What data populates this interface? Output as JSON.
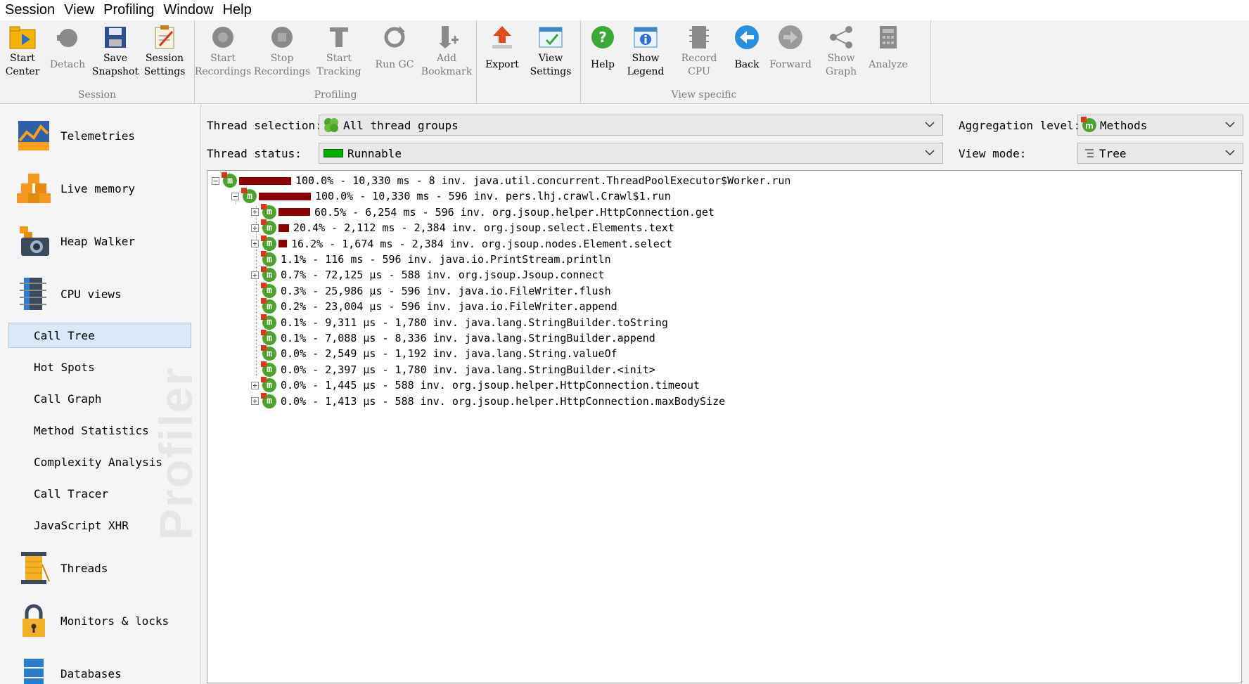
{
  "menu": [
    "Session",
    "View",
    "Profiling",
    "Window",
    "Help"
  ],
  "toolbar": {
    "groups": [
      {
        "label": "Session"
      },
      {
        "label": "Profiling"
      },
      {
        "label": ""
      },
      {
        "label": "View specific"
      }
    ],
    "buttons": {
      "start_center": "Start\nCenter",
      "detach": "Detach",
      "save_snapshot": "Save\nSnapshot",
      "session_settings": "Session\nSettings",
      "start_recordings": "Start\nRecordings",
      "stop_recordings": "Stop\nRecordings",
      "start_tracking": "Start\nTracking",
      "run_gc": "Run GC",
      "add_bookmark": "Add\nBookmark",
      "export": "Export",
      "view_settings": "View\nSettings",
      "help": "Help",
      "show_legend": "Show\nLegend",
      "record_cpu": "Record\nCPU",
      "back": "Back",
      "forward": "Forward",
      "show_graph": "Show\nGraph",
      "analyze": "Analyze"
    }
  },
  "sidebar": {
    "sections": {
      "telemetries": "Telemetries",
      "live_memory": "Live memory",
      "heap_walker": "Heap Walker",
      "cpu_views": "CPU views",
      "threads": "Threads",
      "monitors": "Monitors & locks",
      "databases": "Databases"
    },
    "cpu_items": [
      "Call Tree",
      "Hot Spots",
      "Call Graph",
      "Method Statistics",
      "Complexity Analysis",
      "Call Tracer",
      "JavaScript XHR"
    ],
    "selected": "Call Tree",
    "watermark": "Profiler"
  },
  "controls": {
    "thread_selection_label": "Thread selection:",
    "thread_selection_value": "All thread groups",
    "thread_status_label": "Thread status:",
    "thread_status_value": "Runnable",
    "aggregation_label": "Aggregation level:",
    "aggregation_value": "Methods",
    "view_mode_label": "View mode:",
    "view_mode_value": "Tree"
  },
  "tree": [
    {
      "text": "100.0% - 10,330 ms - 8 inv. java.util.concurrent.ThreadPoolExecutor$Worker.run",
      "pct": 100.0,
      "depth": 0,
      "expander": "minus"
    },
    {
      "text": "100.0% - 10,330 ms - 596 inv. pers.lhj.crawl.Crawl$1.run",
      "pct": 100.0,
      "depth": 1,
      "expander": "minus"
    },
    {
      "text": "60.5% - 6,254 ms - 596 inv. org.jsoup.helper.HttpConnection.get",
      "pct": 60.5,
      "depth": 2,
      "expander": "plus"
    },
    {
      "text": "20.4% - 2,112 ms - 2,384 inv. org.jsoup.select.Elements.text",
      "pct": 20.4,
      "depth": 2,
      "expander": "plus"
    },
    {
      "text": "16.2% - 1,674 ms - 2,384 inv. org.jsoup.nodes.Element.select",
      "pct": 16.2,
      "depth": 2,
      "expander": "plus"
    },
    {
      "text": "1.1% - 116 ms - 596 inv. java.io.PrintStream.println",
      "pct": 1.1,
      "depth": 2,
      "expander": "none"
    },
    {
      "text": "0.7% - 72,125 µs - 588 inv. org.jsoup.Jsoup.connect",
      "pct": 0.7,
      "depth": 2,
      "expander": "plus"
    },
    {
      "text": "0.3% - 25,986 µs - 596 inv. java.io.FileWriter.flush",
      "pct": 0.3,
      "depth": 2,
      "expander": "none"
    },
    {
      "text": "0.2% - 23,004 µs - 596 inv. java.io.FileWriter.append",
      "pct": 0.2,
      "depth": 2,
      "expander": "none"
    },
    {
      "text": "0.1% - 9,311 µs - 1,780 inv. java.lang.StringBuilder.toString",
      "pct": 0.1,
      "depth": 2,
      "expander": "none"
    },
    {
      "text": "0.1% - 7,088 µs - 8,336 inv. java.lang.StringBuilder.append",
      "pct": 0.1,
      "depth": 2,
      "expander": "none"
    },
    {
      "text": "0.0% - 2,549 µs - 1,192 inv. java.lang.String.valueOf",
      "pct": 0.0,
      "depth": 2,
      "expander": "none"
    },
    {
      "text": "0.0% - 2,397 µs - 1,780 inv. java.lang.StringBuilder.<init>",
      "pct": 0.0,
      "depth": 2,
      "expander": "none"
    },
    {
      "text": "0.0% - 1,445 µs - 588 inv. org.jsoup.helper.HttpConnection.timeout",
      "pct": 0.0,
      "depth": 2,
      "expander": "plus"
    },
    {
      "text": "0.0% - 1,413 µs - 588 inv. org.jsoup.helper.HttpConnection.maxBodySize",
      "pct": 0.0,
      "depth": 2,
      "expander": "plus"
    }
  ],
  "colors": {
    "bar": "#8b0000",
    "method_icon": "#4aa32a",
    "selection": "#dbe8f7",
    "runnable": "#00b000"
  }
}
